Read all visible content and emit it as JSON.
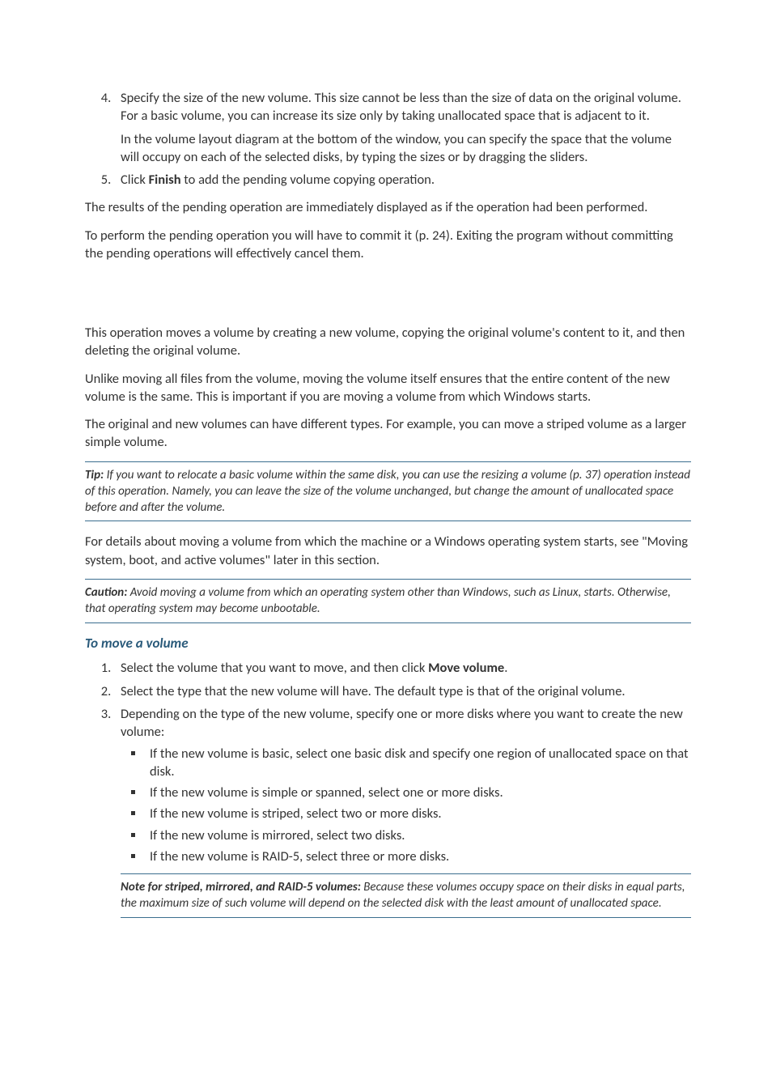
{
  "steps_a": [
    {
      "num": "4",
      "text": "Specify the size of the new volume. This size cannot be less than the size of data on the original volume. For a basic volume, you can increase its size only by taking unallocated space that is adjacent to it.",
      "extra": "In the volume layout diagram at the bottom of the window, you can specify the space that the volume will occupy on each of the selected disks, by typing the sizes or by dragging the sliders."
    },
    {
      "num": "5",
      "text_pre": "Click ",
      "bold": "Finish",
      "text_post": " to add the pending volume copying operation."
    }
  ],
  "para_a1": "The results of the pending operation are immediately displayed as if the operation had been performed.",
  "para_a2": "To perform the pending operation you will have to commit it (p. 24). Exiting the program without committing the pending operations will effectively cancel them.",
  "para_b1": "This operation moves a volume by creating a new volume, copying the original volume's content to it, and then deleting the original volume.",
  "para_b2": "Unlike moving all files from the volume, moving the volume itself ensures that the entire content of the new volume is the same. This is important if you are moving a volume from which Windows starts.",
  "para_b3": "The original and new volumes can have different types. For example, you can move a striped volume as a larger simple volume.",
  "tip": {
    "label": "Tip:",
    "text": " If you want to relocate a basic volume within the same disk, you can use the resizing a volume (p. 37) operation instead of this operation. Namely, you can leave the size of the volume unchanged, but change the amount of unallocated space before and after the volume."
  },
  "para_b4": "For details about moving a volume from which the machine or a Windows operating system starts, see \"Moving system, boot, and active volumes\" later in this section.",
  "caution": {
    "label": "Caution:",
    "text": " Avoid moving a volume from which an operating system other than Windows, such as Linux, starts. Otherwise, that operating system may become unbootable."
  },
  "heading_move": "To move a volume",
  "steps_b": {
    "s1_pre": "Select the volume that you want to move, and then click ",
    "s1_bold": "Move volume",
    "s1_post": ".",
    "s2": "Select the type that the new volume will have. The default type is that of the original volume.",
    "s3": "Depending on the type of the new volume, specify one or more disks where you want to create the new volume:",
    "bullets": [
      "If the new volume is basic, select one basic disk and specify one region of unallocated space on that disk.",
      "If the new volume is simple or spanned, select one or more disks.",
      "If the new volume is striped, select two or more disks.",
      "If the new volume is mirrored, select two disks.",
      "If the new volume is RAID-5, select three or more disks."
    ]
  },
  "note": {
    "label": "Note for striped, mirrored, and RAID-5 volumes:",
    "text": " Because these volumes occupy space on their disks in equal parts, the maximum size of such volume will depend on the selected disk with the least amount of unallocated space."
  }
}
